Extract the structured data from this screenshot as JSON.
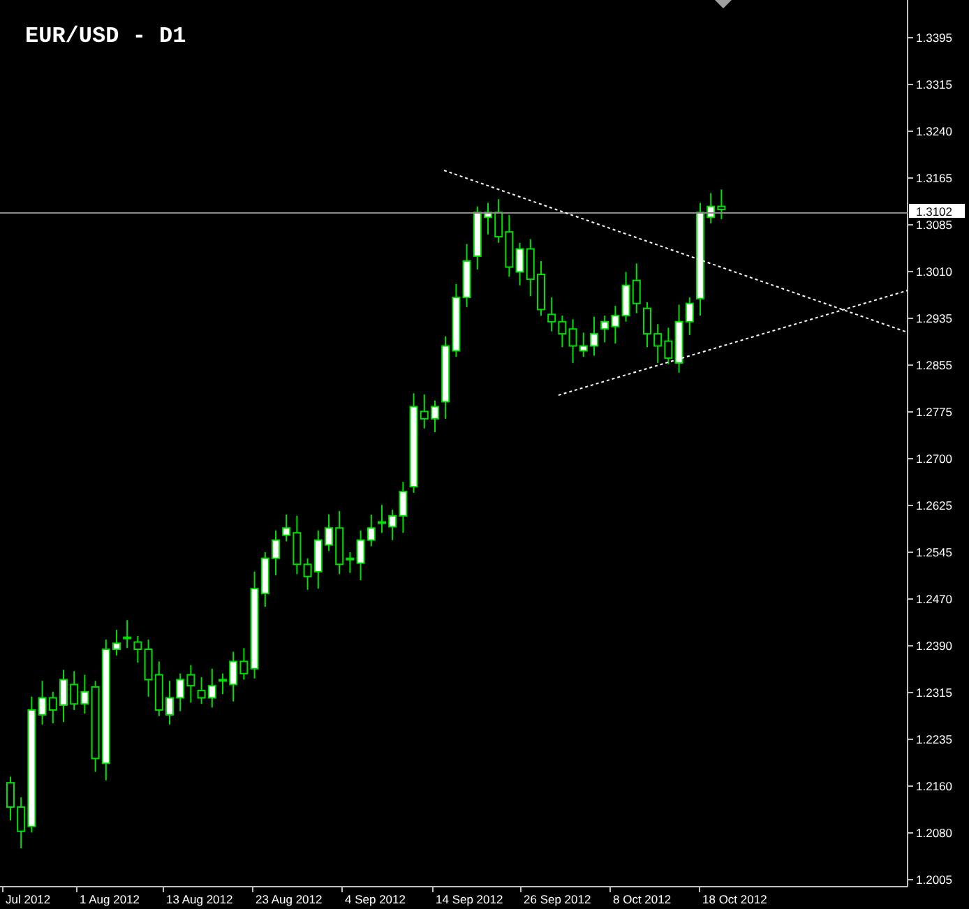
{
  "chart": {
    "title": "EUR/USD - D1",
    "current_price": "1.3102",
    "price_axis": [
      "1.3395",
      "1.3315",
      "1.3240",
      "1.3165",
      "1.3085",
      "1.3010",
      "1.2935",
      "1.2855",
      "1.2775",
      "1.2700",
      "1.2625",
      "1.2545",
      "1.2470",
      "1.2390",
      "1.2315",
      "1.2235",
      "1.2160",
      "1.2080",
      "1.2005"
    ],
    "time_axis": [
      "Jul 2012",
      "1 Aug 2012",
      "13 Aug 2012",
      "23 Aug 2012",
      "4 Sep 2012",
      "14 Sep 2012",
      "26 Sep 2012",
      "8 Oct 2012",
      "18 Oct 2012"
    ]
  }
}
